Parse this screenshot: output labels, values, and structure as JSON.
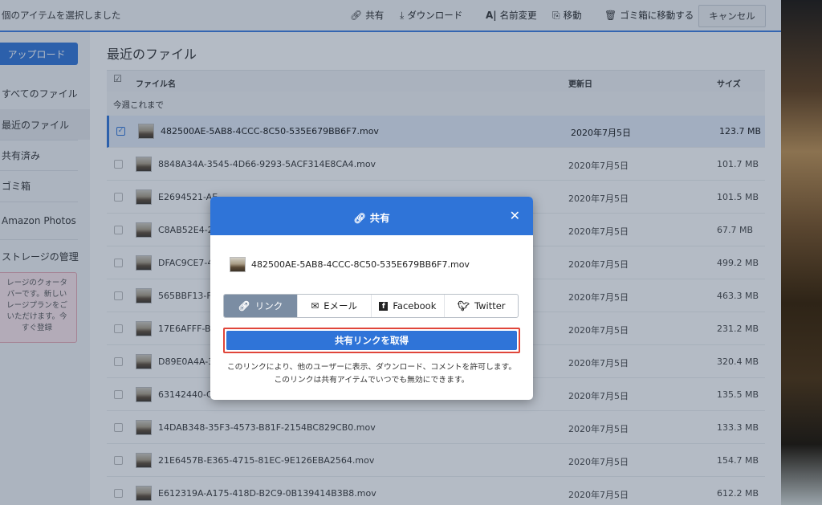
{
  "toolbar": {
    "selection_text": "個のアイテムを選択しました",
    "share": "共有",
    "download": "ダウンロード",
    "rename": "名前変更",
    "move": "移動",
    "trash": "ゴミ箱に移動する",
    "cancel": "キャンセル"
  },
  "sidebar": {
    "upload": "アップロード",
    "items": [
      {
        "label": "すべてのファイル"
      },
      {
        "label": "最近のファイル"
      },
      {
        "label": "共有済み"
      },
      {
        "label": "ゴミ箱"
      },
      {
        "label": "Amazon Photos"
      },
      {
        "label": "ストレージの管理"
      }
    ],
    "quota_lines": [
      "レージのクォータ",
      "バーです。新しい",
      "レージプランをご",
      "いただけます。今",
      "すぐ登録"
    ]
  },
  "main": {
    "title": "最近のファイル",
    "columns": {
      "name": "ファイル名",
      "modified": "更新日",
      "size": "サイズ"
    },
    "group": "今週これまで",
    "rows": [
      {
        "name": "482500AE-5AB8-4CCC-8C50-535E679BB6F7.mov",
        "date": "2020年7月5日",
        "size": "123.7 MB"
      },
      {
        "name": "8848A34A-3545-4D66-9293-5ACF314E8CA4.mov",
        "date": "2020年7月5日",
        "size": "101.7 MB"
      },
      {
        "name": "E2694521-AE",
        "date": "2020年7月5日",
        "size": "101.5 MB"
      },
      {
        "name": "C8AB52E4-2",
        "date": "2020年7月5日",
        "size": "67.7 MB"
      },
      {
        "name": "DFAC9CE7-4",
        "date": "2020年7月5日",
        "size": "499.2 MB"
      },
      {
        "name": "565BBF13-F",
        "date": "2020年7月5日",
        "size": "463.3 MB"
      },
      {
        "name": "17E6AFFF-B",
        "date": "2020年7月5日",
        "size": "231.2 MB"
      },
      {
        "name": "D89E0A4A-3",
        "date": "2020年7月5日",
        "size": "320.4 MB"
      },
      {
        "name": "63142440-C",
        "date": "2020年7月5日",
        "size": "135.5 MB"
      },
      {
        "name": "14DAB348-35F3-4573-B81F-2154BC829CB0.mov",
        "date": "2020年7月5日",
        "size": "133.3 MB"
      },
      {
        "name": "21E6457B-E365-4715-81EC-9E126EBA2564.mov",
        "date": "2020年7月5日",
        "size": "154.7 MB"
      },
      {
        "name": "E612319A-A175-418D-B2C9-0B139414B3B8.mov",
        "date": "2020年7月5日",
        "size": "612.2 MB"
      }
    ]
  },
  "modal": {
    "title": "共有",
    "file_name": "482500AE-5AB8-4CCC-8C50-535E679BB6F7.mov",
    "tabs": [
      {
        "label": "リンク",
        "icon": "link-icon"
      },
      {
        "label": "Eメール",
        "icon": "envelope-icon"
      },
      {
        "label": "Facebook",
        "icon": "facebook-icon"
      },
      {
        "label": "Twitter",
        "icon": "twitter-icon"
      }
    ],
    "get_link": "共有リンクを取得",
    "note": "このリンクにより、他のユーザーに表示、ダウンロード、コメントを許可します。このリンクは共有アイテムでいつでも無効にできます。"
  },
  "colors": {
    "accent": "#2f74d8",
    "highlight": "#e0463a"
  }
}
